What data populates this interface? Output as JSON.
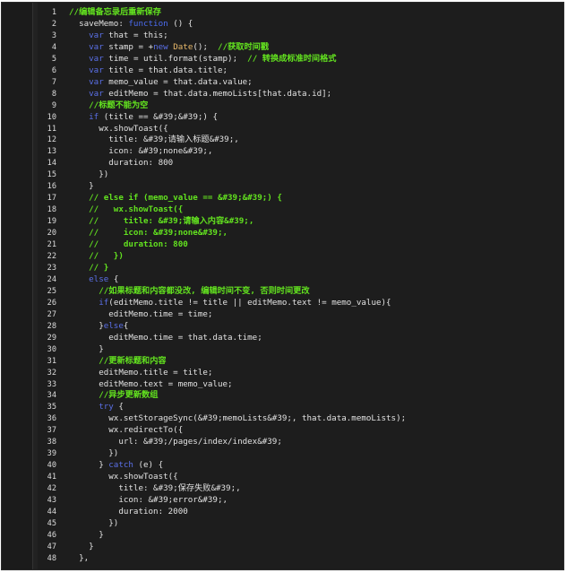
{
  "editor": {
    "lines": [
      {
        "n": "1",
        "tokens": [
          {
            "t": "//编辑备忘录后重新保存",
            "c": "comment"
          }
        ]
      },
      {
        "n": "2",
        "tokens": [
          {
            "t": "  saveMemo: ",
            "c": "plain"
          },
          {
            "t": "function",
            "c": "fn"
          },
          {
            "t": " () {",
            "c": "plain"
          }
        ]
      },
      {
        "n": "3",
        "tokens": [
          {
            "t": "    ",
            "c": "plain"
          },
          {
            "t": "var",
            "c": "kw"
          },
          {
            "t": " that = this;",
            "c": "plain"
          }
        ]
      },
      {
        "n": "4",
        "tokens": [
          {
            "t": "    ",
            "c": "plain"
          },
          {
            "t": "var",
            "c": "kw"
          },
          {
            "t": " stamp = +",
            "c": "plain"
          },
          {
            "t": "new",
            "c": "kw"
          },
          {
            "t": " ",
            "c": "plain"
          },
          {
            "t": "Date",
            "c": "cls"
          },
          {
            "t": "();  ",
            "c": "plain"
          },
          {
            "t": "//获取时间戳",
            "c": "comment"
          }
        ]
      },
      {
        "n": "5",
        "tokens": [
          {
            "t": "    ",
            "c": "plain"
          },
          {
            "t": "var",
            "c": "kw"
          },
          {
            "t": " time = util.format(stamp);  ",
            "c": "plain"
          },
          {
            "t": "// 转换成标准时间格式",
            "c": "comment"
          }
        ]
      },
      {
        "n": "6",
        "tokens": [
          {
            "t": "    ",
            "c": "plain"
          },
          {
            "t": "var",
            "c": "kw"
          },
          {
            "t": " title = that.data.title;",
            "c": "plain"
          }
        ]
      },
      {
        "n": "7",
        "tokens": [
          {
            "t": "    ",
            "c": "plain"
          },
          {
            "t": "var",
            "c": "kw"
          },
          {
            "t": " memo_value = that.data.value;",
            "c": "plain"
          }
        ]
      },
      {
        "n": "8",
        "tokens": [
          {
            "t": "    ",
            "c": "plain"
          },
          {
            "t": "var",
            "c": "kw"
          },
          {
            "t": " editMemo = that.data.memoLists[that.data.id];",
            "c": "plain"
          }
        ]
      },
      {
        "n": "9",
        "tokens": [
          {
            "t": "    ",
            "c": "plain"
          },
          {
            "t": "//标题不能为空",
            "c": "comment"
          }
        ]
      },
      {
        "n": "10",
        "tokens": [
          {
            "t": "    ",
            "c": "plain"
          },
          {
            "t": "if",
            "c": "kw"
          },
          {
            "t": " (title == &#39;&#39;) {",
            "c": "plain"
          }
        ]
      },
      {
        "n": "11",
        "tokens": [
          {
            "t": "      wx.showToast({",
            "c": "plain"
          }
        ]
      },
      {
        "n": "12",
        "tokens": [
          {
            "t": "        title: &#39;请输入标题&#39;,",
            "c": "plain"
          }
        ]
      },
      {
        "n": "13",
        "tokens": [
          {
            "t": "        icon: &#39;none&#39;,",
            "c": "plain"
          }
        ]
      },
      {
        "n": "14",
        "tokens": [
          {
            "t": "        duration: 800",
            "c": "plain"
          }
        ]
      },
      {
        "n": "15",
        "tokens": [
          {
            "t": "      })",
            "c": "plain"
          }
        ]
      },
      {
        "n": "16",
        "tokens": [
          {
            "t": "    }",
            "c": "plain"
          }
        ]
      },
      {
        "n": "17",
        "tokens": [
          {
            "t": "    ",
            "c": "plain"
          },
          {
            "t": "// else if (memo_value == &#39;&#39;) {",
            "c": "comment"
          }
        ]
      },
      {
        "n": "18",
        "tokens": [
          {
            "t": "    ",
            "c": "plain"
          },
          {
            "t": "//   wx.showToast({",
            "c": "comment"
          }
        ]
      },
      {
        "n": "19",
        "tokens": [
          {
            "t": "    ",
            "c": "plain"
          },
          {
            "t": "//     title: &#39;请输入内容&#39;,",
            "c": "comment"
          }
        ]
      },
      {
        "n": "20",
        "tokens": [
          {
            "t": "    ",
            "c": "plain"
          },
          {
            "t": "//     icon: &#39;none&#39;,",
            "c": "comment"
          }
        ]
      },
      {
        "n": "21",
        "tokens": [
          {
            "t": "    ",
            "c": "plain"
          },
          {
            "t": "//     duration: 800",
            "c": "comment"
          }
        ]
      },
      {
        "n": "22",
        "tokens": [
          {
            "t": "    ",
            "c": "plain"
          },
          {
            "t": "//   })",
            "c": "comment"
          }
        ]
      },
      {
        "n": "23",
        "tokens": [
          {
            "t": "    ",
            "c": "plain"
          },
          {
            "t": "// }",
            "c": "comment"
          }
        ]
      },
      {
        "n": "24",
        "tokens": [
          {
            "t": "    ",
            "c": "plain"
          },
          {
            "t": "else",
            "c": "kw"
          },
          {
            "t": " {",
            "c": "plain"
          }
        ]
      },
      {
        "n": "25",
        "tokens": [
          {
            "t": "      ",
            "c": "plain"
          },
          {
            "t": "//如果标题和内容都没改, 编辑时间不变, 否则时间更改",
            "c": "comment"
          }
        ]
      },
      {
        "n": "26",
        "tokens": [
          {
            "t": "      ",
            "c": "plain"
          },
          {
            "t": "if",
            "c": "kw"
          },
          {
            "t": "(editMemo.title != title || editMemo.text != memo_value){",
            "c": "plain"
          }
        ]
      },
      {
        "n": "27",
        "tokens": [
          {
            "t": "        editMemo.time = time;",
            "c": "plain"
          }
        ]
      },
      {
        "n": "28",
        "tokens": [
          {
            "t": "      }",
            "c": "plain"
          },
          {
            "t": "else",
            "c": "kw"
          },
          {
            "t": "{",
            "c": "plain"
          }
        ]
      },
      {
        "n": "29",
        "tokens": [
          {
            "t": "        editMemo.time = that.data.time;",
            "c": "plain"
          }
        ]
      },
      {
        "n": "30",
        "tokens": [
          {
            "t": "      }",
            "c": "plain"
          }
        ]
      },
      {
        "n": "31",
        "tokens": [
          {
            "t": "      ",
            "c": "plain"
          },
          {
            "t": "//更新标题和内容",
            "c": "comment"
          }
        ]
      },
      {
        "n": "32",
        "tokens": [
          {
            "t": "      editMemo.title = title;",
            "c": "plain"
          }
        ]
      },
      {
        "n": "33",
        "tokens": [
          {
            "t": "      editMemo.text = memo_value;",
            "c": "plain"
          }
        ]
      },
      {
        "n": "34",
        "tokens": [
          {
            "t": "      ",
            "c": "plain"
          },
          {
            "t": "//异步更新数组",
            "c": "comment"
          }
        ]
      },
      {
        "n": "35",
        "tokens": [
          {
            "t": "      ",
            "c": "plain"
          },
          {
            "t": "try",
            "c": "kw"
          },
          {
            "t": " {",
            "c": "plain"
          }
        ]
      },
      {
        "n": "36",
        "tokens": [
          {
            "t": "        wx.setStorageSync(&#39;memoLists&#39;, that.data.memoLists);",
            "c": "plain"
          }
        ]
      },
      {
        "n": "37",
        "tokens": [
          {
            "t": "        wx.redirectTo({",
            "c": "plain"
          }
        ]
      },
      {
        "n": "38",
        "tokens": [
          {
            "t": "          url: &#39;/pages/index/index&#39;",
            "c": "plain"
          }
        ]
      },
      {
        "n": "39",
        "tokens": [
          {
            "t": "        })",
            "c": "plain"
          }
        ]
      },
      {
        "n": "40",
        "tokens": [
          {
            "t": "      } ",
            "c": "plain"
          },
          {
            "t": "catch",
            "c": "kw"
          },
          {
            "t": " (e) {",
            "c": "plain"
          }
        ]
      },
      {
        "n": "41",
        "tokens": [
          {
            "t": "        wx.showToast({",
            "c": "plain"
          }
        ]
      },
      {
        "n": "42",
        "tokens": [
          {
            "t": "          title: &#39;保存失败&#39;,",
            "c": "plain"
          }
        ]
      },
      {
        "n": "43",
        "tokens": [
          {
            "t": "          icon: &#39;error&#39;,",
            "c": "plain"
          }
        ]
      },
      {
        "n": "44",
        "tokens": [
          {
            "t": "          duration: 2000",
            "c": "plain"
          }
        ]
      },
      {
        "n": "45",
        "tokens": [
          {
            "t": "        })",
            "c": "plain"
          }
        ]
      },
      {
        "n": "46",
        "tokens": [
          {
            "t": "      }",
            "c": "plain"
          }
        ]
      },
      {
        "n": "47",
        "tokens": [
          {
            "t": "    }",
            "c": "plain"
          }
        ]
      },
      {
        "n": "48",
        "tokens": [
          {
            "t": "  },",
            "c": "plain"
          }
        ]
      }
    ]
  }
}
